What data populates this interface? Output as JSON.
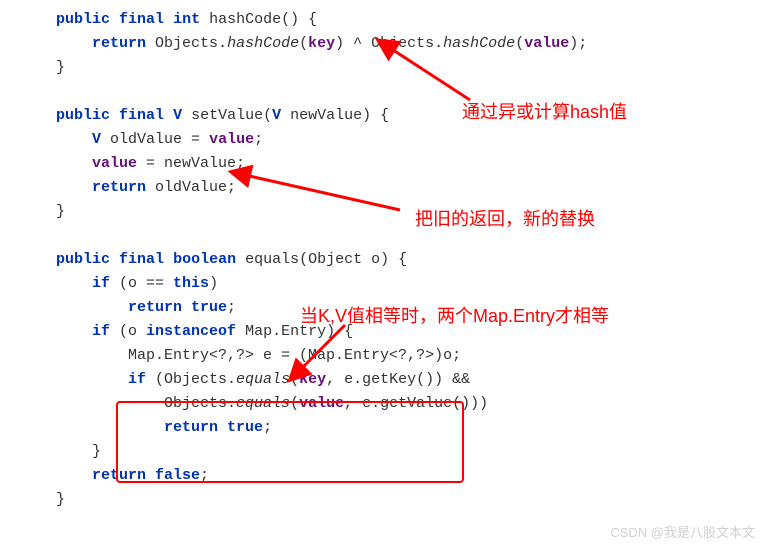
{
  "code": {
    "l1a": "public",
    "l1b": "final",
    "l1c": "int",
    "l1d": "hashCode",
    "l1e": "() {",
    "l2a": "return",
    "l2b": "Objects",
    "l2c": ".",
    "l2d": "hashCode",
    "l2e": "(",
    "l2f": "key",
    "l2g": ") ^ ",
    "l2h": "Objects",
    "l2i": ".",
    "l2j": "hashCode",
    "l2k": "(",
    "l2l": "value",
    "l2m": ");",
    "l3a": "}",
    "l4a": "public",
    "l4b": "final",
    "l4c": "V",
    "l4d": "setValue",
    "l4e": "(",
    "l4f": "V",
    "l4g": " newValue) {",
    "l5a": "V",
    "l5b": " oldValue = ",
    "l5c": "value",
    "l5d": ";",
    "l6a": "value",
    "l6b": " = newValue;",
    "l7a": "return",
    "l7b": " oldValue;",
    "l8a": "}",
    "l9a": "public",
    "l9b": "final",
    "l9c": "boolean",
    "l9d": "equals",
    "l9e": "(Object o) {",
    "l10a": "if",
    "l10b": " (o == ",
    "l10c": "this",
    "l10d": ")",
    "l11a": "return true",
    "l11b": ";",
    "l12a": "if",
    "l12b": " (o ",
    "l12c": "instanceof",
    "l12d": " Map.Entry) {",
    "l13a": "Map.Entry<?,?> e = (Map.Entry<?,?>)o;",
    "l14a": "if",
    "l14b": " (Objects.",
    "l14c": "equals",
    "l14d": "(",
    "l14e": "key",
    "l14f": ", e.getKey()) &&",
    "l15a": "Objects.",
    "l15b": "equals",
    "l15c": "(",
    "l15d": "value",
    "l15e": ", e.getValue()))",
    "l16a": "return true",
    "l16b": ";",
    "l17a": "}",
    "l18a": "return false",
    "l18b": ";",
    "l19a": "}"
  },
  "annotations": {
    "a1": "通过异或计算hash值",
    "a2": "把旧的返回，新的替换",
    "a3": "当K,V值相等时，两个Map.Entry才相等"
  },
  "watermark": "CSDN @我是八股文本文"
}
